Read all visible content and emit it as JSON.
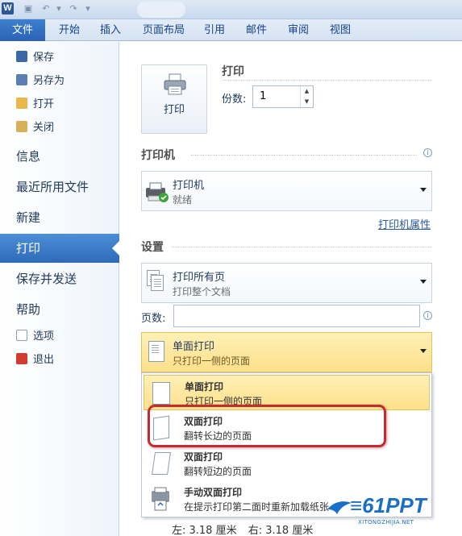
{
  "titlebar": {
    "logo_letter": "W"
  },
  "tabs": {
    "file": "文件",
    "items": [
      "开始",
      "插入",
      "页面布局",
      "引用",
      "邮件",
      "审阅",
      "视图"
    ]
  },
  "nav": {
    "save": "保存",
    "save_as": "另存为",
    "open": "打开",
    "close": "关闭",
    "info": "信息",
    "recent": "最近所用文件",
    "new": "新建",
    "print": "打印",
    "save_send": "保存并发送",
    "help": "帮助",
    "options": "选项",
    "exit": "退出"
  },
  "print": {
    "button_label": "打印",
    "heading": "打印",
    "copies_label": "份数:",
    "copies_value": "1",
    "printer_heading": "打印机",
    "printer_name": "打印机",
    "printer_status": "就绪",
    "printer_properties": "打印机属性",
    "settings_heading": "设置",
    "range_title": "打印所有页",
    "range_desc": "打印整个文档",
    "pages_label": "页数:",
    "pages_value": "",
    "sides_title": "单面打印",
    "sides_desc": "只打印一侧的页面"
  },
  "sides_menu": [
    {
      "title": "单面打印",
      "desc": "只打印一侧的页面"
    },
    {
      "title": "双面打印",
      "desc": "翻转长边的页面"
    },
    {
      "title": "双面打印",
      "desc": "翻转短边的页面"
    },
    {
      "title": "手动双面打印",
      "desc": "在提示打印第二面时重新加载纸张"
    }
  ],
  "margins": {
    "left": "左:  3.18 厘米",
    "right": "右:  3.18 厘米"
  },
  "watermark": {
    "big": "≡61PPT",
    "small": "XITONGZHIJIA.NET"
  },
  "colors": {
    "accent": "#2e6bb8",
    "highlight": "#fde08a",
    "annotation": "#c22b32"
  },
  "icons": {
    "info": "info-icon",
    "printer": "printer-icon",
    "dropdown": "dropdown-arrow-icon"
  }
}
